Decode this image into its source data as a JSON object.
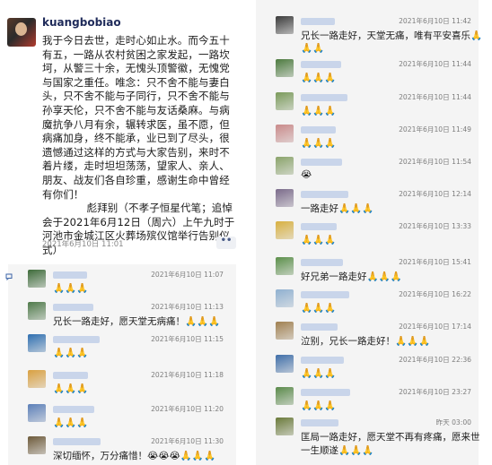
{
  "post": {
    "author": "kuangbobiao",
    "lines": [
      "我于今日去世，走时心如止水。而今五十",
      "有五，一路从农村贫困之家发起，一路坎",
      "坷，从警三十余，无愧头顶警徽，无愧党",
      "与国家之重任。唯念：只不舍不能与妻白",
      "头，只不舍不能与子同行，只不舍不能与",
      "孙享天伦，只不舍不能与友话桑麻。与病",
      "魔抗争八月有余，辗转求医，虽不愿，但",
      "病痛加身，终不能承，业已到了尽头，很",
      "遗憾通过这样的方式与大家告别，来时不",
      "着片缕，走时坦坦荡荡，望家人、亲人、",
      "朋友、战友们各自珍重，感谢生命中曾经",
      "有你们！"
    ],
    "signature": "彪拜别（不孝子恒星代笔；追悼",
    "signature_lines": [
      "会于2021年6月12日（周六）上午九时于",
      "河池市金城江区火葬场殡仪馆举行告别仪",
      "式）"
    ],
    "time": "2021年6月10日 11:01",
    "more_label": "••"
  },
  "left_comments": [
    {
      "time": "2021年6月10日 11:07",
      "text": "🙏🙏🙏",
      "avatar_color": "#3e6b3a"
    },
    {
      "time": "2021年6月10日 11:13",
      "text": "兄长一路走好，愿天堂无病痛！🙏🙏🙏",
      "avatar_color": "#4f7a4a"
    },
    {
      "time": "2021年6月10日 11:15",
      "text": "🙏🙏🙏",
      "avatar_color": "#2f6fb0"
    },
    {
      "time": "2021年6月10日 11:18",
      "text": "🙏🙏🙏",
      "avatar_color": "#d9a040"
    },
    {
      "time": "2021年6月10日 11:20",
      "text": "🙏🙏🙏",
      "avatar_color": "#5b7fb8"
    },
    {
      "time": "2021年6月10日 11:30",
      "text": "深切缅怀，万分痛惜！😭😭😭🙏🙏🙏",
      "avatar_color": "#6d5a3a"
    }
  ],
  "right_comments": [
    {
      "time": "2021年6月10日 11:42",
      "text": "兄长一路走好，天堂无痛，唯有平安喜乐🙏",
      "text2": "🙏🙏",
      "avatar_color": "#3a3a3a"
    },
    {
      "time": "2021年6月10日 11:44",
      "text": "🙏🙏🙏",
      "avatar_color": "#4c7a3e"
    },
    {
      "time": "2021年6月10日 11:44",
      "text": "🙏🙏🙏",
      "avatar_color": "#7a9a5a"
    },
    {
      "time": "2021年6月10日 11:49",
      "text": "🙏🙏🙏",
      "avatar_color": "#c98a8a"
    },
    {
      "time": "2021年6月10日 11:54",
      "text": "😭",
      "avatar_color": "#8aa36a"
    },
    {
      "time": "2021年6月10日 12:14",
      "text": "一路走好🙏🙏🙏",
      "avatar_color": "#7a6a8a"
    },
    {
      "time": "2021年6月10日 13:33",
      "text": "🙏🙏🙏",
      "avatar_color": "#d8b040"
    },
    {
      "time": "2021年6月10日 15:41",
      "text": "好兄弟一路走好🙏🙏🙏",
      "avatar_color": "#5b8f4a"
    },
    {
      "time": "2021年6月10日 16:22",
      "text": "🙏🙏🙏",
      "avatar_color": "#8fb0d0"
    },
    {
      "time": "2021年6月10日 17:14",
      "text": "泣别，兄长一路走好！🙏🙏🙏",
      "avatar_color": "#a08050"
    },
    {
      "time": "2021年6月10日 22:36",
      "text": "🙏🙏🙏",
      "avatar_color": "#3f6ea8"
    },
    {
      "time": "2021年6月10日 23:27",
      "text": "🙏🙏🙏",
      "avatar_color": "#5a8a4a"
    },
    {
      "time": "昨天 03:00",
      "text": "匡局一路走好，愿天堂不再有疼痛，愿来世",
      "text2": "一生顺遂🙏🙏🙏",
      "avatar_color": "#6a7a3a"
    }
  ]
}
